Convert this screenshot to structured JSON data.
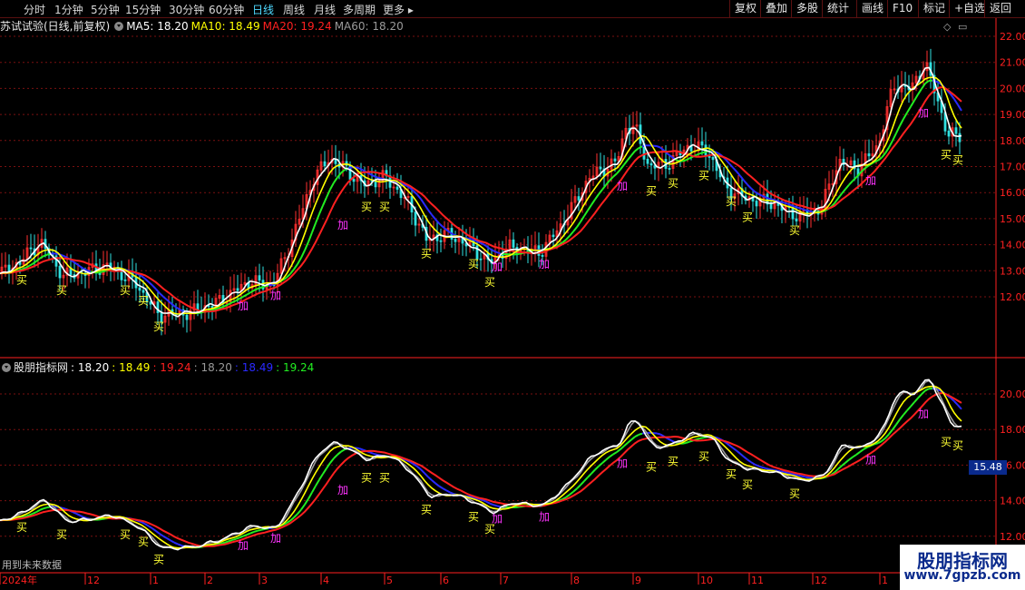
{
  "toolbar": {
    "timeframes": [
      "分时",
      "1分钟",
      "5分钟",
      "15分钟",
      "30分钟",
      "60分钟",
      "日线",
      "周线",
      "月线",
      "多周期",
      "更多"
    ],
    "active_timeframe": "日线",
    "buttons": [
      "复权",
      "叠加",
      "多股",
      "统计",
      "画线",
      "F10",
      "标记",
      "+自选",
      "返回"
    ]
  },
  "main_panel": {
    "title": "苏试试验(日线,前复权)",
    "indicators": [
      {
        "label": "MA5: 18.20",
        "color": "#ffffff"
      },
      {
        "label": "MA10: 18.49",
        "color": "#ffff00"
      },
      {
        "label": "MA20: 19.24",
        "color": "#ff2020"
      },
      {
        "label": "MA60: 18.20",
        "color": "#9a9a9a"
      }
    ],
    "y_ticks": [
      "22.00",
      "21.00",
      "20.00",
      "19.00",
      "18.00",
      "17.00",
      "16.00",
      "15.00",
      "14.00",
      "13.00",
      "12.00"
    ]
  },
  "sub_panel": {
    "title": "股朋指标网",
    "values": [
      {
        "label": ": 18.20",
        "color": "#ffffff"
      },
      {
        "label": ": 18.49",
        "color": "#ffff00"
      },
      {
        "label": ": 19.24",
        "color": "#ff2020"
      },
      {
        "label": ": 18.20",
        "color": "#9a9a9a"
      },
      {
        "label": ": 18.49",
        "color": "#2a2aff"
      },
      {
        "label": ": 19.24",
        "color": "#22ee22"
      }
    ],
    "y_ticks": [
      "20.00",
      "18.00",
      "16.00",
      "14.00",
      "12.00"
    ],
    "price_label": "15.48",
    "note": "用到未来数据"
  },
  "x_axis": {
    "labels": [
      "2024年",
      "12",
      "1",
      "2",
      "3",
      "4",
      "5",
      "6",
      "7",
      "8",
      "9",
      "10",
      "11",
      "12",
      "1"
    ]
  },
  "signals": {
    "buy": "买",
    "add": "加"
  },
  "watermark": {
    "line1": "股朋指标网",
    "line2": "www.7gpzb.com"
  },
  "colors": {
    "up": "#ff3030",
    "down": "#30e0e0",
    "grid": "#7a1010",
    "axis": "#ff2020",
    "ma20": "#ff2020",
    "ma60green": "#22ee22",
    "blue": "#2a2aff"
  },
  "chart_data": {
    "type": "line",
    "title": "苏试试验(日线,前复权)",
    "xlabel": "",
    "ylabel": "",
    "ylim": [
      11.0,
      22.4
    ],
    "x": [
      "2024年",
      "12",
      "1",
      "2",
      "3",
      "4",
      "5",
      "6",
      "7",
      "8",
      "9",
      "10",
      "11",
      "12",
      "1"
    ],
    "series": [
      {
        "name": "MA5",
        "values": [
          12.8,
          13.3,
          12.6,
          11.2,
          12.7,
          17.1,
          16.2,
          14.1,
          13.7,
          17.6,
          17.3,
          17.8,
          15.6,
          17.2,
          20.6,
          18.2
        ]
      },
      {
        "name": "MA10",
        "values": [
          12.6,
          13.1,
          12.9,
          11.3,
          12.4,
          16.6,
          16.5,
          14.4,
          13.7,
          16.9,
          17.4,
          17.6,
          15.8,
          16.8,
          20.0,
          18.49
        ]
      },
      {
        "name": "MA20",
        "values": [
          12.0,
          13.0,
          13.1,
          11.6,
          12.0,
          15.4,
          16.7,
          14.6,
          13.8,
          16.0,
          17.6,
          17.6,
          16.1,
          16.2,
          19.4,
          19.24
        ]
      },
      {
        "name": "MA60",
        "values": [
          12.8,
          13.3,
          12.6,
          11.2,
          12.7,
          17.1,
          16.2,
          14.1,
          13.7,
          17.6,
          17.3,
          17.8,
          15.6,
          17.2,
          20.6,
          18.2
        ]
      }
    ]
  }
}
